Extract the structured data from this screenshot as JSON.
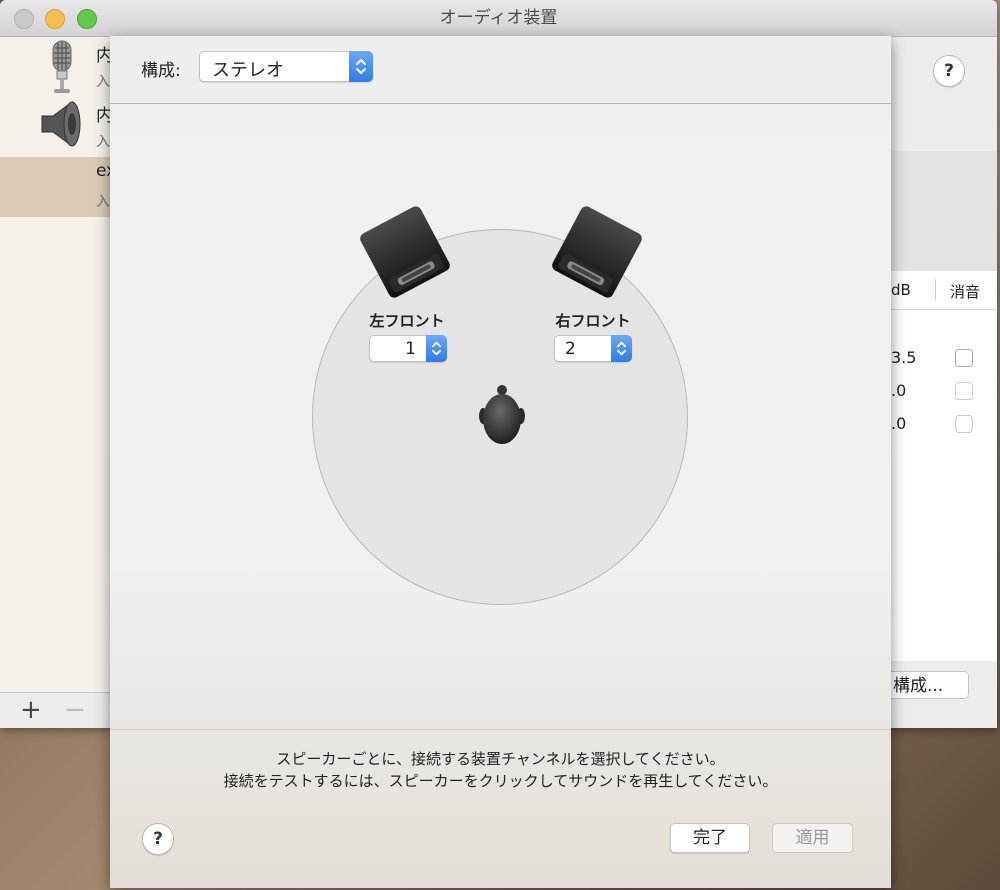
{
  "window": {
    "title": "オーディオ装置",
    "devices": [
      {
        "name": "内",
        "sub": "入"
      },
      {
        "name": "内",
        "sub": "入"
      },
      {
        "name": "ex",
        "sub": "入"
      }
    ],
    "add_label": "+",
    "remove_label": "−"
  },
  "right_panel": {
    "help": "?",
    "db_header": "dB",
    "mute_header": "消音",
    "values": [
      "3.5",
      ".0",
      ".0"
    ],
    "configure_button": "構成..."
  },
  "sheet": {
    "config_label": "構成:",
    "config_value": "ステレオ",
    "left_speaker": {
      "label": "左フロント",
      "channel": "1"
    },
    "right_speaker": {
      "label": "右フロント",
      "channel": "2"
    },
    "instruction_line1": "スピーカーごとに、接続する装置チャンネルを選択してください。",
    "instruction_line2": "接続をテストするには、スピーカーをクリックしてサウンドを再生してください。",
    "help": "?",
    "done_button": "完了",
    "apply_button": "適用"
  },
  "colors": {
    "accent_blue": "#2f7be8",
    "selection": "#d9cbb8",
    "close_light": "#c9c9c9",
    "minimize_light": "#f5be4f",
    "maximize_light": "#5fc94b"
  }
}
